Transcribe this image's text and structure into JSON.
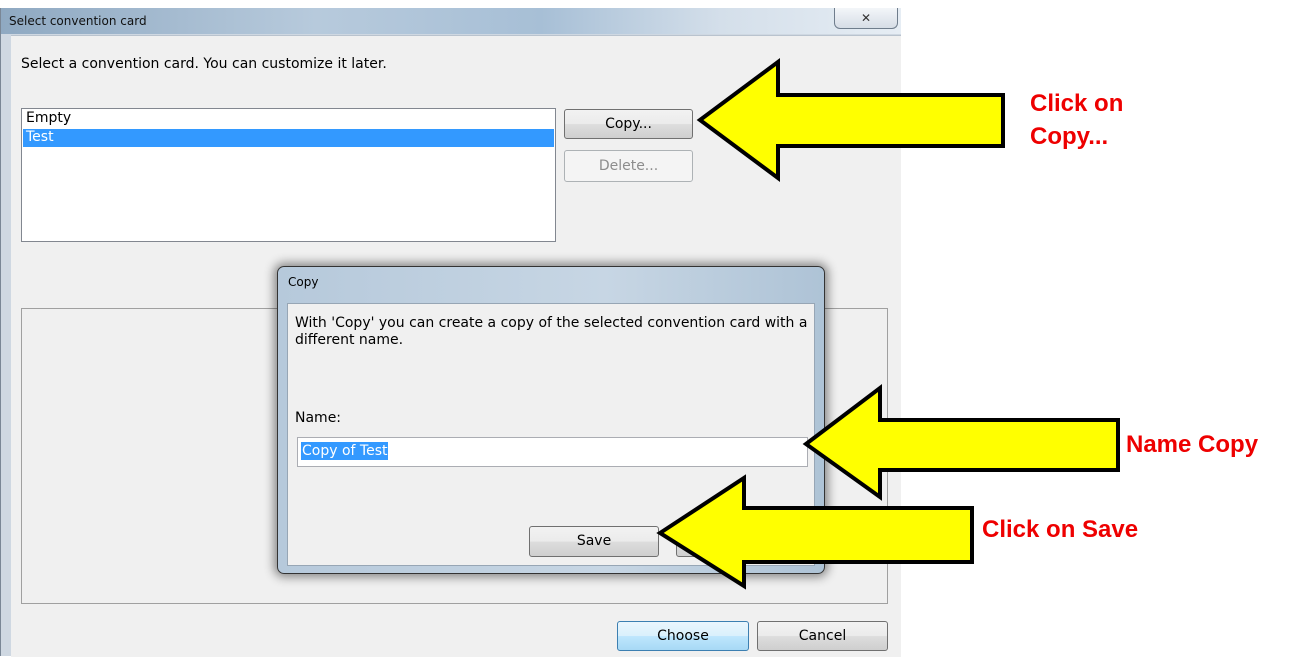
{
  "window": {
    "title": "Select convention card",
    "close_glyph": "✕",
    "instruction": "Select a convention card. You can customize it later.",
    "list_items": [
      {
        "label": "Empty",
        "selected": false
      },
      {
        "label": "Test",
        "selected": true
      }
    ],
    "copy_label": "Copy...",
    "delete_label": "Delete...",
    "choose_label": "Choose",
    "cancel_label": "Cancel"
  },
  "copy_dialog": {
    "title": "Copy",
    "description": "With 'Copy' you can create a copy of the selected convention card with a different name.",
    "name_label": "Name:",
    "name_value": "Copy of Test",
    "save_label": "Save"
  },
  "annotations": {
    "copy_line1": "Click on",
    "copy_line2": "Copy...",
    "name": "Name Copy",
    "save": "Click on Save",
    "arrow_fill": "#ffff00",
    "text_color": "#ee0000"
  },
  "colors": {
    "selection": "#3399ff",
    "annotation_red": "#ee0000",
    "arrow_yellow": "#ffff00"
  }
}
